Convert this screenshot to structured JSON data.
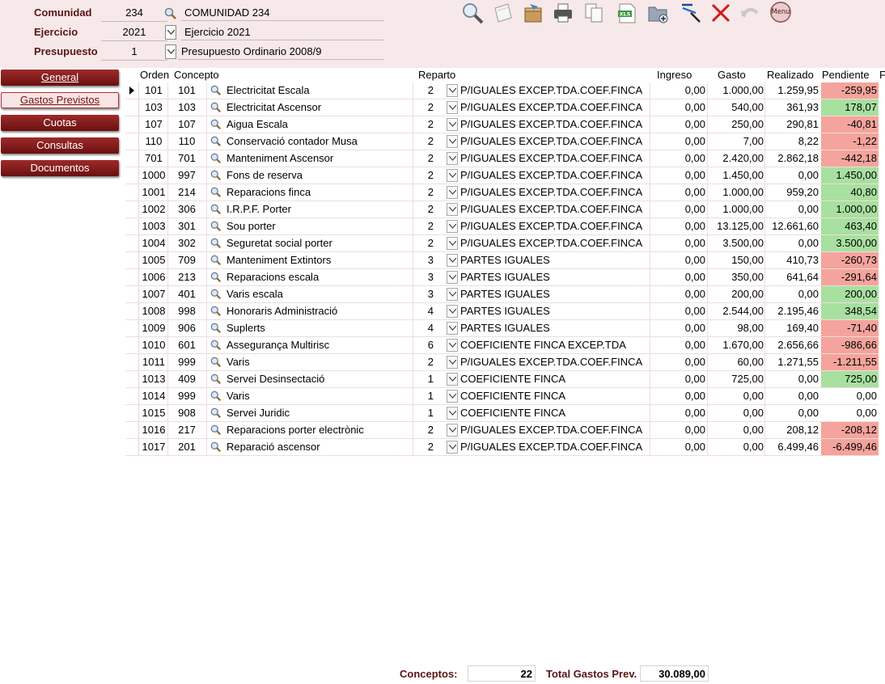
{
  "header": {
    "comunidad": {
      "label": "Comunidad",
      "code": "234",
      "name": "COMUNIDAD 234"
    },
    "ejercicio": {
      "label": "Ejercicio",
      "code": "2021",
      "name": "Ejercicio 2021"
    },
    "presupuesto": {
      "label": "Presupuesto",
      "code": "1",
      "name": "Presupuesto Ordinario 2008/9"
    }
  },
  "toolbar": {
    "menu_label": "Menu",
    "xls_label": "XLS"
  },
  "nav": {
    "items": [
      {
        "label": "General"
      },
      {
        "label": "Gastos Previstos"
      },
      {
        "label": "Cuotas"
      },
      {
        "label": "Consultas"
      },
      {
        "label": "Documentos"
      }
    ]
  },
  "columns": {
    "orden": "Orden",
    "concepto": "Concepto",
    "reparto": "Reparto",
    "ingreso": "Ingreso",
    "gasto": "Gasto",
    "realizado": "Realizado",
    "pendiente": "Pendiente",
    "extra": "F"
  },
  "colors": {
    "negative": "#f4a49c",
    "positive": "#a8e0a0",
    "accent": "#7a1a1a"
  },
  "rows": [
    {
      "orden": "101",
      "concepto": "101",
      "desc": "Electricitat Escala",
      "reparto": "2",
      "reparto_name": "P/IGUALES EXCEP.TDA.COEF.FINCA",
      "ingreso": "0,00",
      "gasto": "1.000,00",
      "realizado": "1.259,95",
      "pendiente": "-259,95",
      "status": "neg"
    },
    {
      "orden": "103",
      "concepto": "103",
      "desc": "Electricitat Ascensor",
      "reparto": "2",
      "reparto_name": "P/IGUALES EXCEP.TDA.COEF.FINCA",
      "ingreso": "0,00",
      "gasto": "540,00",
      "realizado": "361,93",
      "pendiente": "178,07",
      "status": "pos"
    },
    {
      "orden": "107",
      "concepto": "107",
      "desc": "Aigua Escala",
      "reparto": "2",
      "reparto_name": "P/IGUALES EXCEP.TDA.COEF.FINCA",
      "ingreso": "0,00",
      "gasto": "250,00",
      "realizado": "290,81",
      "pendiente": "-40,81",
      "status": "neg"
    },
    {
      "orden": "110",
      "concepto": "110",
      "desc": "Conservació contador Musa",
      "reparto": "2",
      "reparto_name": "P/IGUALES EXCEP.TDA.COEF.FINCA",
      "ingreso": "0,00",
      "gasto": "7,00",
      "realizado": "8,22",
      "pendiente": "-1,22",
      "status": "neg"
    },
    {
      "orden": "701",
      "concepto": "701",
      "desc": "Manteniment Ascensor",
      "reparto": "2",
      "reparto_name": "P/IGUALES EXCEP.TDA.COEF.FINCA",
      "ingreso": "0,00",
      "gasto": "2.420,00",
      "realizado": "2.862,18",
      "pendiente": "-442,18",
      "status": "neg"
    },
    {
      "orden": "1000",
      "concepto": "997",
      "desc": "Fons de reserva",
      "reparto": "2",
      "reparto_name": "P/IGUALES EXCEP.TDA.COEF.FINCA",
      "ingreso": "0,00",
      "gasto": "1.450,00",
      "realizado": "0,00",
      "pendiente": "1.450,00",
      "status": "pos"
    },
    {
      "orden": "1001",
      "concepto": "214",
      "desc": "Reparacions finca",
      "reparto": "2",
      "reparto_name": "P/IGUALES EXCEP.TDA.COEF.FINCA",
      "ingreso": "0,00",
      "gasto": "1.000,00",
      "realizado": "959,20",
      "pendiente": "40,80",
      "status": "pos"
    },
    {
      "orden": "1002",
      "concepto": "306",
      "desc": "I.R.P.F. Porter",
      "reparto": "2",
      "reparto_name": "P/IGUALES EXCEP.TDA.COEF.FINCA",
      "ingreso": "0,00",
      "gasto": "1.000,00",
      "realizado": "0,00",
      "pendiente": "1.000,00",
      "status": "pos"
    },
    {
      "orden": "1003",
      "concepto": "301",
      "desc": "Sou porter",
      "reparto": "2",
      "reparto_name": "P/IGUALES EXCEP.TDA.COEF.FINCA",
      "ingreso": "0,00",
      "gasto": "13.125,00",
      "realizado": "12.661,60",
      "pendiente": "463,40",
      "status": "pos"
    },
    {
      "orden": "1004",
      "concepto": "302",
      "desc": "Seguretat social porter",
      "reparto": "2",
      "reparto_name": "P/IGUALES EXCEP.TDA.COEF.FINCA",
      "ingreso": "0,00",
      "gasto": "3.500,00",
      "realizado": "0,00",
      "pendiente": "3.500,00",
      "status": "pos"
    },
    {
      "orden": "1005",
      "concepto": "709",
      "desc": "Manteniment Extintors",
      "reparto": "3",
      "reparto_name": "PARTES IGUALES",
      "ingreso": "0,00",
      "gasto": "150,00",
      "realizado": "410,73",
      "pendiente": "-260,73",
      "status": "neg"
    },
    {
      "orden": "1006",
      "concepto": "213",
      "desc": "Reparacions escala",
      "reparto": "3",
      "reparto_name": "PARTES IGUALES",
      "ingreso": "0,00",
      "gasto": "350,00",
      "realizado": "641,64",
      "pendiente": "-291,64",
      "status": "neg"
    },
    {
      "orden": "1007",
      "concepto": "401",
      "desc": "Varis escala",
      "reparto": "3",
      "reparto_name": "PARTES IGUALES",
      "ingreso": "0,00",
      "gasto": "200,00",
      "realizado": "0,00",
      "pendiente": "200,00",
      "status": "pos"
    },
    {
      "orden": "1008",
      "concepto": "998",
      "desc": "Honoraris Administració",
      "reparto": "4",
      "reparto_name": "PARTES IGUALES",
      "ingreso": "0,00",
      "gasto": "2.544,00",
      "realizado": "2.195,46",
      "pendiente": "348,54",
      "status": "pos"
    },
    {
      "orden": "1009",
      "concepto": "906",
      "desc": "Suplerts",
      "reparto": "4",
      "reparto_name": "PARTES IGUALES",
      "ingreso": "0,00",
      "gasto": "98,00",
      "realizado": "169,40",
      "pendiente": "-71,40",
      "status": "neg"
    },
    {
      "orden": "1010",
      "concepto": "601",
      "desc": "Assegurança Multirisc",
      "reparto": "6",
      "reparto_name": "COEFICIENTE FINCA EXCEP.TDA",
      "ingreso": "0,00",
      "gasto": "1.670,00",
      "realizado": "2.656,66",
      "pendiente": "-986,66",
      "status": "neg"
    },
    {
      "orden": "1011",
      "concepto": "999",
      "desc": "Varis",
      "reparto": "2",
      "reparto_name": "P/IGUALES EXCEP.TDA.COEF.FINCA",
      "ingreso": "0,00",
      "gasto": "60,00",
      "realizado": "1.271,55",
      "pendiente": "-1.211,55",
      "status": "neg"
    },
    {
      "orden": "1013",
      "concepto": "409",
      "desc": "Servei Desinsectació",
      "reparto": "1",
      "reparto_name": "COEFICIENTE FINCA",
      "ingreso": "0,00",
      "gasto": "725,00",
      "realizado": "0,00",
      "pendiente": "725,00",
      "status": "pos"
    },
    {
      "orden": "1014",
      "concepto": "999",
      "desc": "Varis",
      "reparto": "1",
      "reparto_name": "COEFICIENTE FINCA",
      "ingreso": "0,00",
      "gasto": "0,00",
      "realizado": "0,00",
      "pendiente": "0,00",
      "status": "zero"
    },
    {
      "orden": "1015",
      "concepto": "908",
      "desc": "Servei Juridic",
      "reparto": "1",
      "reparto_name": "COEFICIENTE FINCA",
      "ingreso": "0,00",
      "gasto": "0,00",
      "realizado": "0,00",
      "pendiente": "0,00",
      "status": "zero"
    },
    {
      "orden": "1016",
      "concepto": "217",
      "desc": "Reparacions porter electrònic",
      "reparto": "2",
      "reparto_name": "P/IGUALES EXCEP.TDA.COEF.FINCA",
      "ingreso": "0,00",
      "gasto": "0,00",
      "realizado": "208,12",
      "pendiente": "-208,12",
      "status": "neg"
    },
    {
      "orden": "1017",
      "concepto": "201",
      "desc": "Reparació ascensor",
      "reparto": "2",
      "reparto_name": "P/IGUALES EXCEP.TDA.COEF.FINCA",
      "ingreso": "0,00",
      "gasto": "0,00",
      "realizado": "6.499,46",
      "pendiente": "-6.499,46",
      "status": "neg"
    }
  ],
  "footer": {
    "conceptos_label": "Conceptos:",
    "conceptos_value": "22",
    "total_label": "Total Gastos Prev.",
    "total_value": "30.089,00"
  }
}
